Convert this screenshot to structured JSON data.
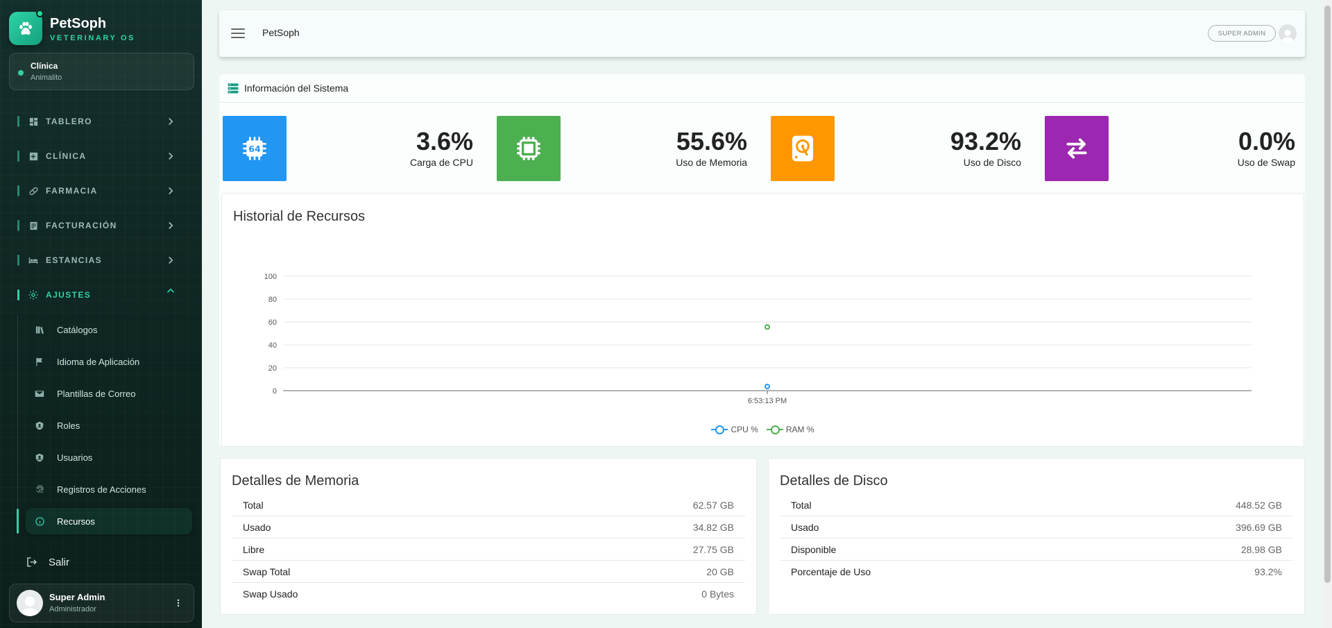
{
  "brand": {
    "name": "PetSoph",
    "tagline": "VETERINARY OS"
  },
  "clinic": {
    "label": "Clínica",
    "name": "Animalito"
  },
  "nav": {
    "sections": [
      {
        "label": "TABLERO",
        "icon": "dashboard-icon"
      },
      {
        "label": "CLÍNICA",
        "icon": "medical-plus-icon"
      },
      {
        "label": "FARMACIA",
        "icon": "pill-icon"
      },
      {
        "label": "FACTURACIÓN",
        "icon": "receipt-icon"
      },
      {
        "label": "ESTANCIAS",
        "icon": "bed-icon"
      },
      {
        "label": "AJUSTES",
        "icon": "gear-icon"
      }
    ],
    "settings_items": [
      {
        "label": "Catálogos",
        "icon": "books-icon"
      },
      {
        "label": "Idioma de Aplicación",
        "icon": "flag-icon"
      },
      {
        "label": "Plantillas de Correo",
        "icon": "mail-template-icon"
      },
      {
        "label": "Roles",
        "icon": "shield-icon"
      },
      {
        "label": "Usuarios",
        "icon": "user-shield-icon"
      },
      {
        "label": "Registros de Acciones",
        "icon": "fingerprint-icon"
      },
      {
        "label": "Recursos",
        "icon": "info-icon"
      }
    ],
    "logout_label": "Salir"
  },
  "user": {
    "name": "Super Admin",
    "role": "Administrador"
  },
  "header": {
    "title": "PetSoph",
    "role_badge": "SUPER ADMIN"
  },
  "system": {
    "title": "Información del Sistema",
    "stats": [
      {
        "value": "3.6%",
        "label": "Carga de CPU",
        "color": "#2196f3",
        "icon": "cpu-64-icon"
      },
      {
        "value": "55.6%",
        "label": "Uso de Memoria",
        "color": "#4caf50",
        "icon": "memory-chip-icon"
      },
      {
        "value": "93.2%",
        "label": "Uso de Disco",
        "color": "#ff9800",
        "icon": "hard-disk-icon"
      },
      {
        "value": "0.0%",
        "label": "Uso de Swap",
        "color": "#9c27b0",
        "icon": "swap-arrows-icon"
      }
    ]
  },
  "history": {
    "title": "Historial de Recursos"
  },
  "chart_data": {
    "type": "line",
    "x": [
      "6:53:13 PM"
    ],
    "series": [
      {
        "name": "CPU %",
        "values": [
          3.6
        ],
        "color": "#2196f3"
      },
      {
        "name": "RAM %",
        "values": [
          55.6
        ],
        "color": "#4caf50"
      }
    ],
    "ylim": [
      0,
      100
    ],
    "yticks": [
      0,
      20,
      40,
      60,
      80,
      100
    ],
    "grid": true,
    "legend": "bottom-center"
  },
  "memory": {
    "title": "Detalles de Memoria",
    "rows": [
      {
        "key": "Total",
        "value": "62.57 GB"
      },
      {
        "key": "Usado",
        "value": "34.82 GB"
      },
      {
        "key": "Libre",
        "value": "27.75 GB"
      },
      {
        "key": "Swap Total",
        "value": "20 GB"
      },
      {
        "key": "Swap Usado",
        "value": "0 Bytes"
      }
    ]
  },
  "disk": {
    "title": "Detalles de Disco",
    "rows": [
      {
        "key": "Total",
        "value": "448.52 GB"
      },
      {
        "key": "Usado",
        "value": "396.69 GB"
      },
      {
        "key": "Disponible",
        "value": "28.98 GB"
      },
      {
        "key": "Porcentaje de Uso",
        "value": "93.2%"
      }
    ]
  }
}
